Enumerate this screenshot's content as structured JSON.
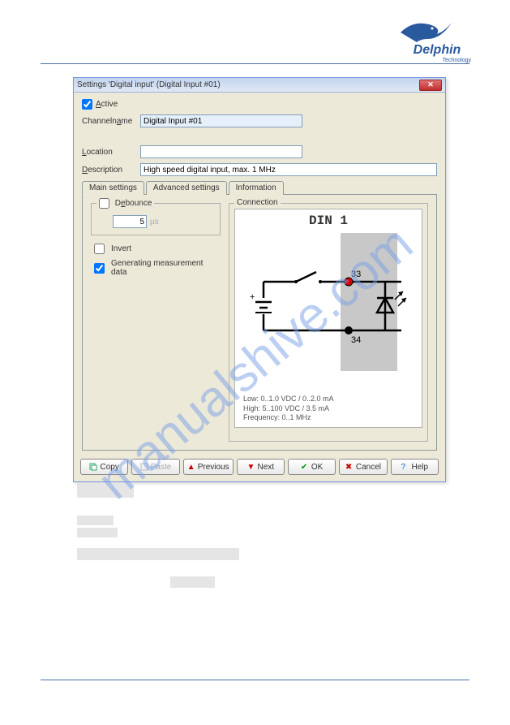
{
  "watermark": "manualshive.com",
  "logo": {
    "brand": "Delphin",
    "sub": "Technology"
  },
  "dialog": {
    "title": "Settings 'Digital input' (Digital Input #01)",
    "active_label": "Active",
    "channelname_label": "Channelname",
    "channelname_value": "Digital Input #01",
    "location_label": "Location",
    "location_value": "",
    "description_label": "Description",
    "description_value": "High speed digital input, max. 1 MHz",
    "tabs": {
      "main": "Main settings",
      "advanced": "Advanced settings",
      "info": "Information"
    },
    "main": {
      "debounce_label": "Debounce",
      "debounce_value": "5",
      "debounce_unit": "µs",
      "invert_label": "Invert",
      "gen_label": "Generating measurement data",
      "conn_legend": "Connection",
      "conn_title": "DIN 1",
      "pin_top": "33",
      "pin_bot": "34",
      "spec_low": "Low: 0..1.0 VDC / 0..2.0 mA",
      "spec_high": "High: 5..100 VDC / 3.5 mA",
      "spec_freq": "Frequency: 0..1 MHz"
    },
    "buttons": {
      "copy": "Copy",
      "paste": "Paste",
      "previous": "Previous",
      "next": "Next",
      "ok": "OK",
      "cancel": "Cancel",
      "help": "Help"
    }
  }
}
